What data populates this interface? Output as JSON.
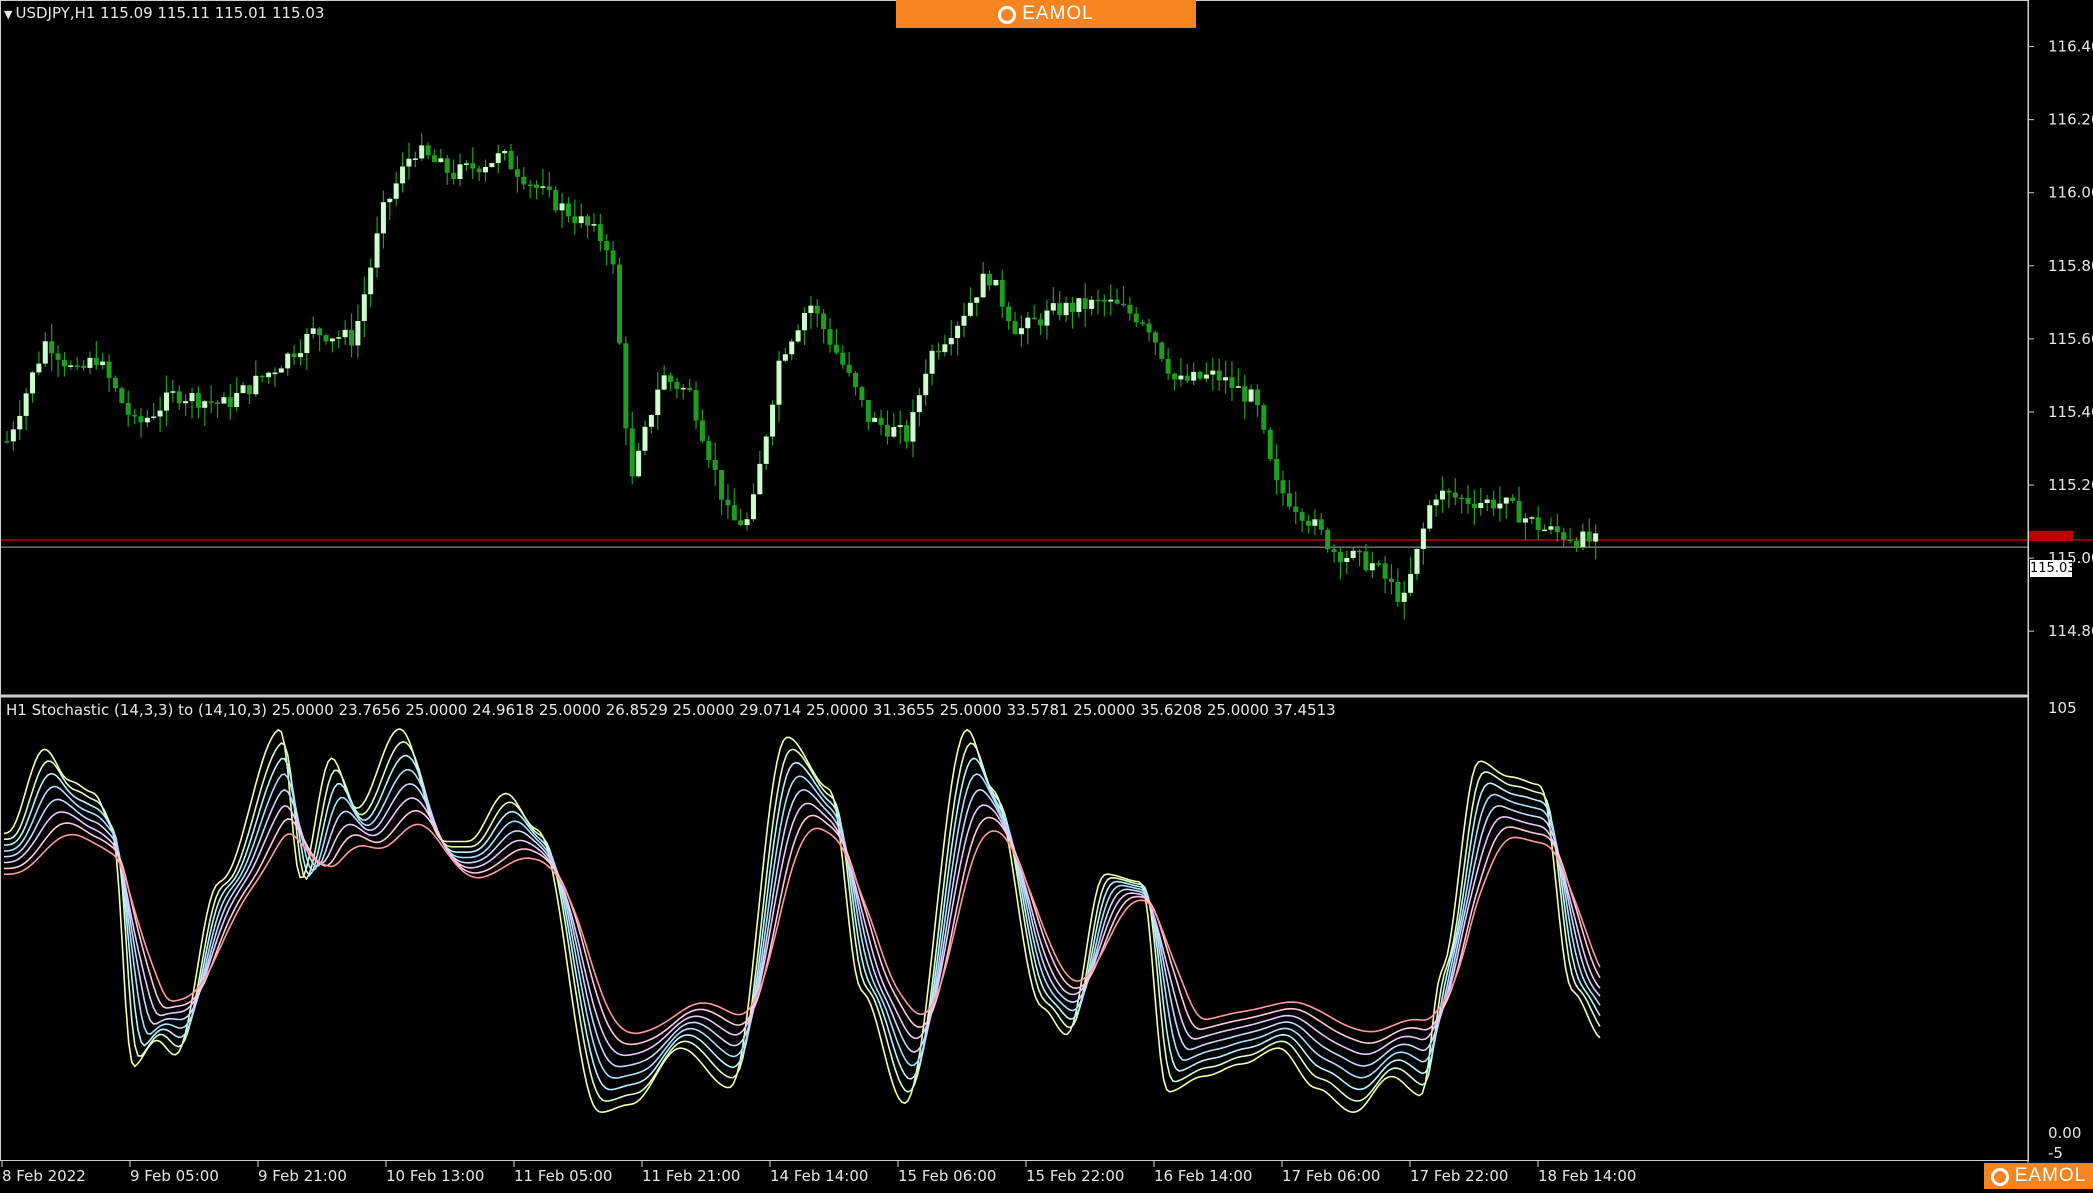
{
  "header": {
    "symbol_line": "USDJPY,H1  115.09 115.11 115.01 115.03",
    "indicator_line": "H1 Stochastic (14,3,3) to (14,10,3) 25.0000 23.7656 25.0000 24.9618 25.0000 26.8529 25.0000 29.0714 25.0000 31.3655 25.0000 33.5781 25.0000 35.6208 25.0000 37.4513"
  },
  "brand": {
    "top_label": "EAMOL",
    "bottom_label": "EAMOL",
    "color": "#f7851f"
  },
  "current_price_label": "115.03",
  "colors": {
    "bull_candle": "#ccffcc",
    "bear_candle": "#1e9e1e",
    "bid_line": "#c00000",
    "ask_line": "#aaaaaa"
  },
  "chart_data": [
    {
      "type": "candlestick",
      "title": "USDJPY,H1",
      "ylim": [
        114.65,
        116.5
      ],
      "y_ticks": [
        "116.40",
        "116.20",
        "116.00",
        "115.80",
        "115.60",
        "115.40",
        "115.20",
        "115.00",
        "114.80"
      ],
      "bid_price": 115.05,
      "ask_price": 115.03,
      "anchors": [
        {
          "t": 0,
          "p": 115.32
        },
        {
          "t": 8,
          "p": 115.6
        },
        {
          "t": 14,
          "p": 115.5
        },
        {
          "t": 18,
          "p": 115.55
        },
        {
          "t": 26,
          "p": 115.36
        },
        {
          "t": 34,
          "p": 115.45
        },
        {
          "t": 44,
          "p": 115.42
        },
        {
          "t": 54,
          "p": 115.52
        },
        {
          "t": 62,
          "p": 115.62
        },
        {
          "t": 70,
          "p": 115.6
        },
        {
          "t": 76,
          "p": 115.95
        },
        {
          "t": 82,
          "p": 116.12
        },
        {
          "t": 90,
          "p": 116.05
        },
        {
          "t": 100,
          "p": 116.1
        },
        {
          "t": 108,
          "p": 116.0
        },
        {
          "t": 116,
          "p": 115.92
        },
        {
          "t": 122,
          "p": 115.85
        },
        {
          "t": 126,
          "p": 115.2
        },
        {
          "t": 132,
          "p": 115.5
        },
        {
          "t": 138,
          "p": 115.45
        },
        {
          "t": 146,
          "p": 115.1
        },
        {
          "t": 150,
          "p": 115.1
        },
        {
          "t": 156,
          "p": 115.55
        },
        {
          "t": 162,
          "p": 115.7
        },
        {
          "t": 168,
          "p": 115.55
        },
        {
          "t": 174,
          "p": 115.38
        },
        {
          "t": 182,
          "p": 115.33
        },
        {
          "t": 186,
          "p": 115.55
        },
        {
          "t": 192,
          "p": 115.65
        },
        {
          "t": 198,
          "p": 115.78
        },
        {
          "t": 204,
          "p": 115.62
        },
        {
          "t": 212,
          "p": 115.68
        },
        {
          "t": 222,
          "p": 115.7
        },
        {
          "t": 230,
          "p": 115.65
        },
        {
          "t": 236,
          "p": 115.48
        },
        {
          "t": 244,
          "p": 115.5
        },
        {
          "t": 252,
          "p": 115.43
        },
        {
          "t": 256,
          "p": 115.2
        },
        {
          "t": 262,
          "p": 115.12
        },
        {
          "t": 268,
          "p": 115.02
        },
        {
          "t": 276,
          "p": 114.98
        },
        {
          "t": 282,
          "p": 114.88
        },
        {
          "t": 288,
          "p": 115.18
        },
        {
          "t": 294,
          "p": 115.16
        },
        {
          "t": 302,
          "p": 115.15
        },
        {
          "t": 310,
          "p": 115.08
        },
        {
          "t": 318,
          "p": 115.05
        },
        {
          "t": 322,
          "p": 115.04
        }
      ],
      "time_ticks": [
        {
          "label": "8 Feb 2022",
          "t": 0
        },
        {
          "label": "9 Feb 05:00",
          "t": 21
        },
        {
          "label": "9 Feb 21:00",
          "t": 41
        },
        {
          "label": "10 Feb 13:00",
          "t": 61
        },
        {
          "label": "11 Feb 05:00",
          "t": 81
        },
        {
          "label": "11 Feb 21:00",
          "t": 101
        },
        {
          "label": "14 Feb 14:00",
          "t": 121
        },
        {
          "label": "15 Feb 06:00",
          "t": 141
        },
        {
          "label": "15 Feb 22:00",
          "t": 161
        },
        {
          "label": "16 Feb 14:00",
          "t": 181
        },
        {
          "label": "17 Feb 06:00",
          "t": 201
        },
        {
          "label": "17 Feb 22:00",
          "t": 221
        },
        {
          "label": "18 Feb 14:00",
          "t": 241
        }
      ]
    },
    {
      "type": "line",
      "title": "H1 Stochastic (14,3,3) to (14,10,3)",
      "ylim": [
        -5,
        105
      ],
      "y_ticks": [
        "105",
        "0.00",
        "-5"
      ],
      "series_colors": [
        "#f4ffa8",
        "#d8ffc4",
        "#b8f4ff",
        "#a8e0ff",
        "#c8d8ff",
        "#e8c8ff",
        "#ffc8e0",
        "#ff9a9a"
      ],
      "x_range": [
        0,
        256
      ],
      "fast_line": [
        {
          "t": 0,
          "v": 74
        },
        {
          "t": 6,
          "v": 95
        },
        {
          "t": 10,
          "v": 87
        },
        {
          "t": 14,
          "v": 84
        },
        {
          "t": 17,
          "v": 75
        },
        {
          "t": 20,
          "v": 16
        },
        {
          "t": 24,
          "v": 23
        },
        {
          "t": 27,
          "v": 19
        },
        {
          "t": 34,
          "v": 62
        },
        {
          "t": 44,
          "v": 100
        },
        {
          "t": 47,
          "v": 62
        },
        {
          "t": 52,
          "v": 93
        },
        {
          "t": 56,
          "v": 80
        },
        {
          "t": 63,
          "v": 100
        },
        {
          "t": 70,
          "v": 72
        },
        {
          "t": 74,
          "v": 72
        },
        {
          "t": 80,
          "v": 84
        },
        {
          "t": 85,
          "v": 75
        },
        {
          "t": 95,
          "v": 5
        },
        {
          "t": 100,
          "v": 7
        },
        {
          "t": 108,
          "v": 21
        },
        {
          "t": 116,
          "v": 11
        },
        {
          "t": 125,
          "v": 98
        },
        {
          "t": 132,
          "v": 85
        },
        {
          "t": 137,
          "v": 35
        },
        {
          "t": 144,
          "v": 7
        },
        {
          "t": 154,
          "v": 100
        },
        {
          "t": 158,
          "v": 85
        },
        {
          "t": 166,
          "v": 31
        },
        {
          "t": 170,
          "v": 24
        },
        {
          "t": 176,
          "v": 64
        },
        {
          "t": 182,
          "v": 62
        },
        {
          "t": 186,
          "v": 10
        },
        {
          "t": 192,
          "v": 14
        },
        {
          "t": 198,
          "v": 17
        },
        {
          "t": 204,
          "v": 21
        },
        {
          "t": 210,
          "v": 11
        },
        {
          "t": 216,
          "v": 5
        },
        {
          "t": 222,
          "v": 14
        },
        {
          "t": 227,
          "v": 9
        },
        {
          "t": 230,
          "v": 40
        },
        {
          "t": 236,
          "v": 92
        },
        {
          "t": 241,
          "v": 88
        },
        {
          "t": 246,
          "v": 86
        },
        {
          "t": 251,
          "v": 35
        },
        {
          "t": 256,
          "v": 23
        }
      ]
    }
  ]
}
